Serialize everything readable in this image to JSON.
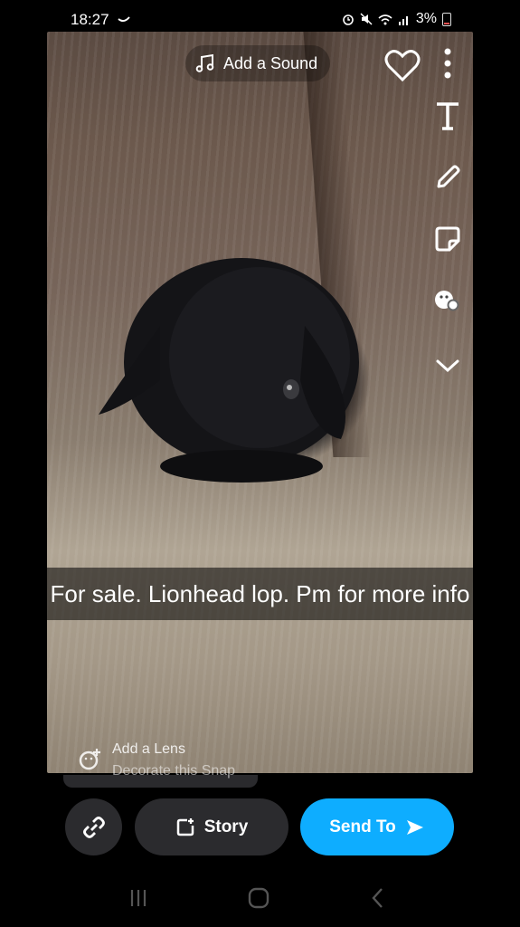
{
  "status_bar": {
    "time": "18:27",
    "battery": "3%"
  },
  "snap": {
    "caption": "For sale. Lionhead lop. Pm for more info",
    "add_sound_label": "Add a Sound"
  },
  "right_tools": {
    "icons": [
      "heart-icon",
      "more-vertical-icon",
      "text-icon",
      "pencil-icon",
      "sticker-icon",
      "emoji-icon",
      "chevron-down-icon"
    ]
  },
  "lens": {
    "title": "Add a Lens",
    "subtitle": "Decorate this Snap"
  },
  "actions": {
    "story_label": "Story",
    "send_label": "Send To"
  },
  "colors": {
    "send_button": "#0eadff",
    "dark_button": "#2b2b2e"
  }
}
